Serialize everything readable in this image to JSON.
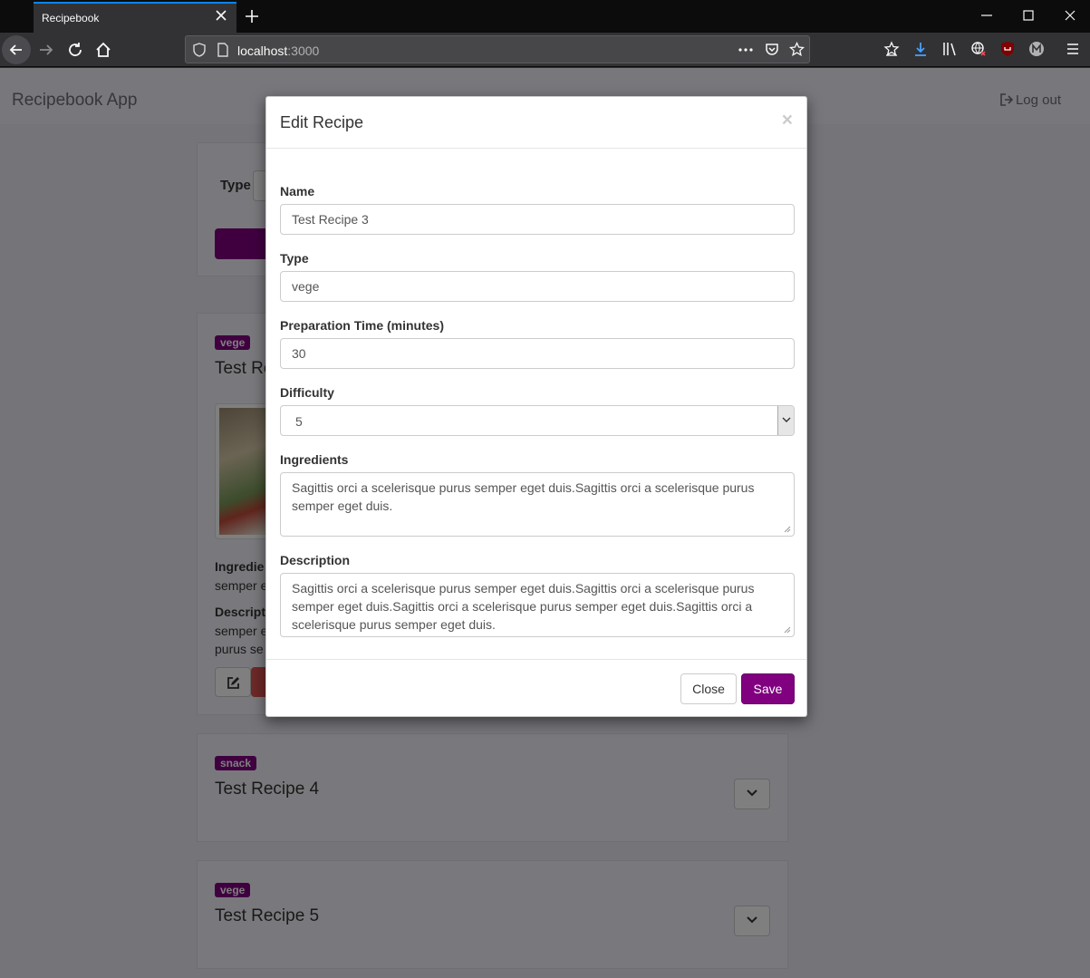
{
  "browser": {
    "tab_title": "Recipebook",
    "url_host": "localhost",
    "url_port": ":3000"
  },
  "app": {
    "brand": "Recipebook App",
    "logout_label": "Log out"
  },
  "filter": {
    "type_label": "Type"
  },
  "recipes": [
    {
      "badge": "vege",
      "title": "Test Re",
      "ingredients_label": "Ingredie",
      "ingredients_text": "semper e",
      "description_label": "Descript",
      "description_line1": "semper e",
      "description_line2": "purus se"
    },
    {
      "badge": "snack",
      "title": "Test Recipe 4"
    },
    {
      "badge": "vege",
      "title": "Test Recipe 5"
    }
  ],
  "modal": {
    "title": "Edit Recipe",
    "close_x": "×",
    "name_label": "Name",
    "name_value": "Test Recipe 3",
    "type_label": "Type",
    "type_value": "vege",
    "prep_label": "Preparation Time (minutes)",
    "prep_value": "30",
    "difficulty_label": "Difficulty",
    "difficulty_value": "5",
    "ingredients_label": "Ingredients",
    "ingredients_value": "Sagittis orci a scelerisque purus semper eget duis.Sagittis orci a scelerisque purus semper eget duis.",
    "description_label": "Description",
    "description_value": "Sagittis orci a scelerisque purus semper eget duis.Sagittis orci a scelerisque purus semper eget duis.Sagittis orci a scelerisque purus semper eget duis.Sagittis orci a scelerisque purus semper eget duis.",
    "close_button": "Close",
    "save_button": "Save"
  },
  "colors": {
    "accent": "#800080",
    "danger": "#d9534f"
  }
}
